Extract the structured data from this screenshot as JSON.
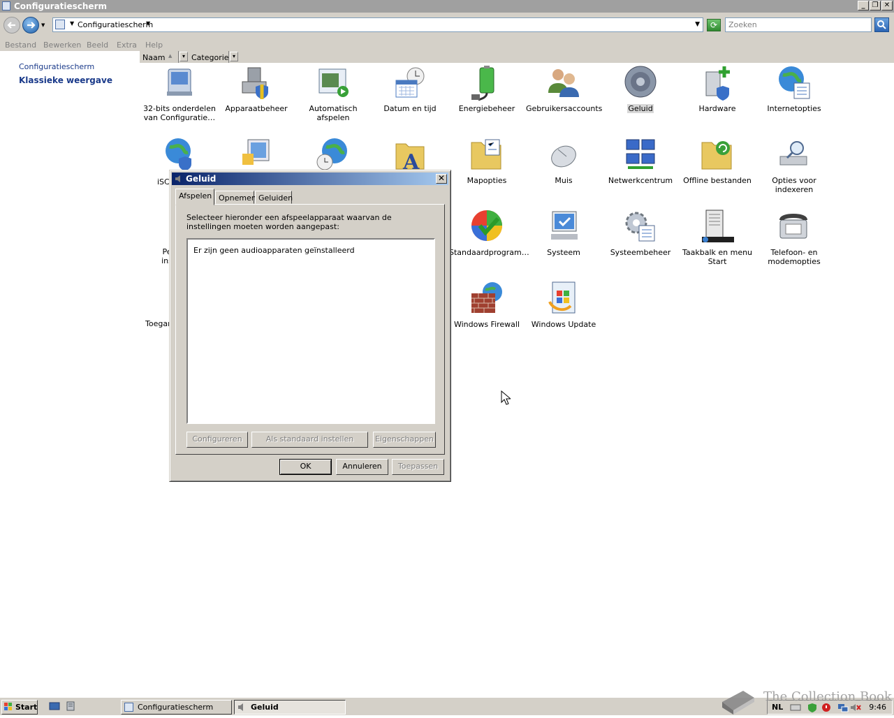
{
  "window": {
    "title": "Configuratiescherm"
  },
  "address": {
    "path": "Configuratiescherm",
    "search_placeholder": "Zoeken"
  },
  "menu": [
    "Bestand",
    "Bewerken",
    "Beeld",
    "Extra",
    "Help"
  ],
  "left_pane": {
    "link": "Configuratiescherm",
    "active": "Klassieke weergave"
  },
  "columns": [
    "Naam",
    "Categorie"
  ],
  "items": [
    {
      "label": "32-bits onderdelen van Configuratie…",
      "icon": "32bit-icon"
    },
    {
      "label": "Apparaatbeheer",
      "icon": "device-manager-icon"
    },
    {
      "label": "Automatisch afspelen",
      "icon": "autoplay-icon"
    },
    {
      "label": "Datum en tijd",
      "icon": "date-time-icon"
    },
    {
      "label": "Energiebeheer",
      "icon": "power-icon"
    },
    {
      "label": "Gebruikersaccounts",
      "icon": "user-accounts-icon"
    },
    {
      "label": "Geluid",
      "icon": "speaker-icon"
    },
    {
      "label": "Hardware",
      "icon": "hardware-icon"
    },
    {
      "label": "Internetopties",
      "icon": "internet-options-icon"
    },
    {
      "label": "iSC",
      "icon": "iscsi-icon"
    },
    {
      "label": "",
      "icon": "display-icon"
    },
    {
      "label": "",
      "icon": "regional-icon"
    },
    {
      "label": "",
      "icon": "fonts-icon"
    },
    {
      "label": "Mapopties",
      "icon": "folder-options-icon"
    },
    {
      "label": "Muis",
      "icon": "mouse-icon"
    },
    {
      "label": "Netwerkcentrum",
      "icon": "network-icon"
    },
    {
      "label": "Offline bestanden",
      "icon": "offline-files-icon"
    },
    {
      "label": "Opties voor indexeren",
      "icon": "indexing-icon"
    },
    {
      "label": "Pe ins",
      "icon": "personalize-icon"
    },
    {
      "label": "Standaardprogram…",
      "icon": "default-programs-icon"
    },
    {
      "label": "Systeem",
      "icon": "system-icon"
    },
    {
      "label": "Systeembeheer",
      "icon": "admin-tools-icon"
    },
    {
      "label": "Taakbalk en menu Start",
      "icon": "taskbar-icon"
    },
    {
      "label": "Telefoon- en modemopties",
      "icon": "phone-modem-icon"
    },
    {
      "label": "Toegan",
      "icon": "accessibility-icon"
    },
    {
      "label": "Windows Firewall",
      "icon": "firewall-icon"
    },
    {
      "label": "Windows Update",
      "icon": "windows-update-icon"
    }
  ],
  "dialog": {
    "title": "Geluid",
    "tabs": [
      "Afspelen",
      "Opnemen",
      "Geluiden"
    ],
    "description": "Selecteer hieronder een afspeelapparaat waarvan de instellingen moeten worden aangepast:",
    "empty_text": "Er zijn geen audioapparaten geïnstalleerd",
    "buttons": {
      "configure": "Configureren",
      "set_default": "Als standaard instellen",
      "properties": "Eigenschappen",
      "ok": "OK",
      "cancel": "Annuleren",
      "apply": "Toepassen"
    }
  },
  "taskbar": {
    "start": "Start",
    "tasks": [
      "Configuratiescherm",
      "Geluid"
    ],
    "lang": "NL",
    "clock": "9:46"
  },
  "watermark": "The Collection Book"
}
